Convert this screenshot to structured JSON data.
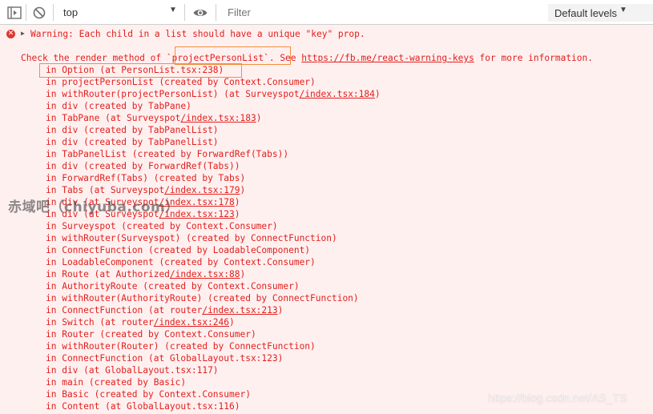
{
  "toolbar": {
    "context": "top",
    "filter_placeholder": "Filter",
    "levels_label": "Default levels"
  },
  "console": {
    "warning_text": "Warning: Each child in a list should have a unique \"key\" prop.",
    "check_prefix": "Check the render method of ",
    "check_component": "`projectPersonList`",
    "check_middle": ". See ",
    "check_link": "https://fb.me/react-warning-keys",
    "check_suffix": " for more information.",
    "stack": [
      {
        "text": "in Option (at PersonList.tsx:238)"
      },
      {
        "text": "in projectPersonList (created by Context.Consumer)"
      },
      {
        "text": "in withRouter(projectPersonList) (at Surveyspot",
        "link": "/index.tsx:184",
        "after": ")"
      },
      {
        "text": "in div (created by TabPane)"
      },
      {
        "text": "in TabPane (at Surveyspot",
        "link": "/index.tsx:183",
        "after": ")"
      },
      {
        "text": "in div (created by TabPanelList)"
      },
      {
        "text": "in div (created by TabPanelList)"
      },
      {
        "text": "in TabPanelList (created by ForwardRef(Tabs))"
      },
      {
        "text": "in div (created by ForwardRef(Tabs))"
      },
      {
        "text": "in ForwardRef(Tabs) (created by Tabs)"
      },
      {
        "text": "in Tabs (at Surveyspot",
        "link": "/index.tsx:179",
        "after": ")"
      },
      {
        "text": "in div (at Surveyspot",
        "link": "/index.tsx:178",
        "after": ")"
      },
      {
        "text": "in div (at Surveyspot",
        "link": "/index.tsx:123",
        "after": ")"
      },
      {
        "text": "in Surveyspot (created by Context.Consumer)"
      },
      {
        "text": "in withRouter(Surveyspot) (created by ConnectFunction)"
      },
      {
        "text": "in ConnectFunction (created by LoadableComponent)"
      },
      {
        "text": "in LoadableComponent (created by Context.Consumer)"
      },
      {
        "text": "in Route (at Authorized",
        "link": "/index.tsx:88",
        "after": ")"
      },
      {
        "text": "in AuthorityRoute (created by Context.Consumer)"
      },
      {
        "text": "in withRouter(AuthorityRoute) (created by ConnectFunction)"
      },
      {
        "text": "in ConnectFunction (at router",
        "link": "/index.tsx:213",
        "after": ")"
      },
      {
        "text": "in Switch (at router",
        "link": "/index.tsx:246",
        "after": ")"
      },
      {
        "text": "in Router (created by Context.Consumer)"
      },
      {
        "text": "in withRouter(Router) (created by ConnectFunction)"
      },
      {
        "text": "in ConnectFunction (at GlobalLayout.tsx:123)"
      },
      {
        "text": "in div (at GlobalLayout.tsx:117)"
      },
      {
        "text": "in main (created by Basic)"
      },
      {
        "text": "in Basic (created by Context.Consumer)"
      },
      {
        "text": "in Content (at GlobalLayout.tsx:116)"
      }
    ]
  },
  "watermark": "赤域吧（chiyuba.com）",
  "credit": "https://blog.csdn.net/AS_TS",
  "colors": {
    "error_text": "#e0201d",
    "error_background": "#fff0f0",
    "highlight_box": "#f0903c"
  },
  "icons": [
    "sidebar-toggle-icon",
    "clear-console-icon",
    "eye-icon",
    "error-icon",
    "expand-arrow-icon"
  ]
}
